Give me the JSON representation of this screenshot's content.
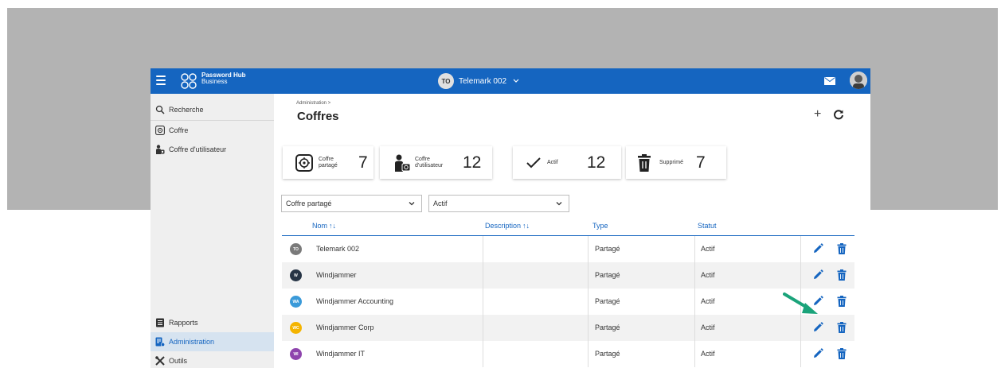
{
  "app": {
    "brand": "Password Hub",
    "brand_sub": "Business",
    "workspace_initials": "TO",
    "workspace_name": "Telemark 002",
    "colors": {
      "primary": "#1565c0",
      "arrow": "#1aa37a"
    }
  },
  "sidebar": {
    "top_items": [
      {
        "label": "Recherche",
        "icon": "search-icon"
      },
      {
        "label": "Coffre",
        "icon": "vault-icon"
      },
      {
        "label": "Coffre d'utilisateur",
        "icon": "user-vault-icon"
      }
    ],
    "bottom_items": [
      {
        "label": "Rapports",
        "icon": "reports-icon"
      },
      {
        "label": "Administration",
        "icon": "administration-icon",
        "active": true
      },
      {
        "label": "Outils",
        "icon": "tools-icon"
      }
    ]
  },
  "main": {
    "breadcrumb": "Administration >",
    "title": "Coffres",
    "plus": "+",
    "stats": [
      {
        "label_1": "Coffre",
        "label_2": "partagé",
        "value": "7",
        "icon": "shared-vault-icon"
      },
      {
        "label_1": "Coffre",
        "label_2": "d'utilisateur",
        "value": "12",
        "icon": "user-vault-icon"
      },
      {
        "label_1": "Actif",
        "label_2": "",
        "value": "12",
        "icon": "check-icon"
      },
      {
        "label_1": "Supprimé",
        "label_2": "",
        "value": "7",
        "icon": "trash-icon"
      }
    ],
    "filters": {
      "type_value": "Coffre partagé",
      "status_value": "Actif"
    },
    "columns": {
      "name": "Nom",
      "description": "Description",
      "type": "Type",
      "status": "Statut"
    },
    "sort_glyph": "↑↓",
    "rows": [
      {
        "initials": "TO",
        "color": "#7a7a7a",
        "name": "Telemark 002",
        "type": "Partagé",
        "status": "Actif"
      },
      {
        "initials": "W",
        "color": "#263445",
        "name": "Windjammer",
        "type": "Partagé",
        "status": "Actif"
      },
      {
        "initials": "WA",
        "color": "#3a9ad9",
        "name": "Windjammer Accounting",
        "type": "Partagé",
        "status": "Actif"
      },
      {
        "initials": "WC",
        "color": "#f4b400",
        "name": "Windjammer Corp",
        "type": "Partagé",
        "status": "Actif"
      },
      {
        "initials": "WI",
        "color": "#8e44ad",
        "name": "Windjammer IT",
        "type": "Partagé",
        "status": "Actif"
      }
    ]
  }
}
